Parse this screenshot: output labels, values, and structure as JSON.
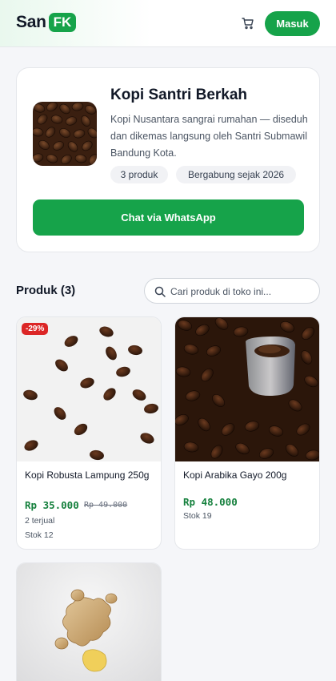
{
  "header": {
    "brand_text": "San",
    "brand_badge": "FK",
    "cart_icon": "cart-icon",
    "login_label": "Masuk"
  },
  "colors": {
    "accent": "#16a34a",
    "price": "#15803d",
    "discount": "#dc2626"
  },
  "store": {
    "name": "Kopi Santri Berkah",
    "description": "Kopi Nusantara sangrai rumahan — diseduh dan dikemas langsung oleh Santri Submawil Bandung Kota.",
    "product_count": "3 produk",
    "joined": "Bergabung sejak 2026",
    "whatsapp_label": "Chat via WhatsApp"
  },
  "products_section": {
    "title": "Produk (3)",
    "search_placeholder": "Cari produk di toko ini...",
    "search_icon": "search-icon"
  },
  "products": [
    {
      "name": "Kopi Robusta Lampung 250g",
      "price": "Rp 35.000",
      "old_price": "Rp 49.000",
      "badge": "-29%",
      "sold": "2 terjual",
      "stock": "Stok 12"
    },
    {
      "name": "Kopi Arabika Gayo 200g",
      "price": "Rp 48.000",
      "stock": "Stok 19"
    },
    {
      "name": ""
    }
  ]
}
